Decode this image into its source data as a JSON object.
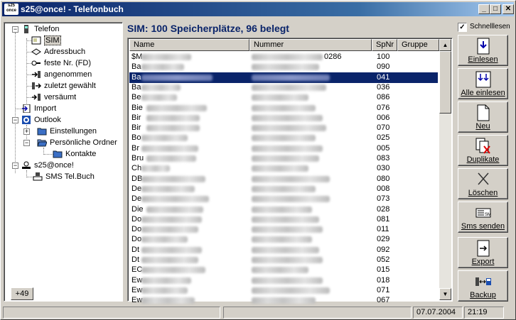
{
  "window": {
    "app_icon_text": "s25 once",
    "title": "s25@once!  -  Telefonbuch",
    "minimize": "_",
    "maximize": "□",
    "close": "✕"
  },
  "tree": {
    "nodes": [
      {
        "label": "Telefon",
        "icon": "phone-icon"
      },
      {
        "label": "SIM",
        "icon": "sim-card-icon"
      },
      {
        "label": "Adressbuch",
        "icon": "address-book-icon"
      },
      {
        "label": "feste Nr. (FD)",
        "icon": "fixed-number-icon"
      },
      {
        "label": "angenommen",
        "icon": "call-received-icon"
      },
      {
        "label": "zuletzt gewählt",
        "icon": "call-dialed-icon"
      },
      {
        "label": "versäumt",
        "icon": "call-missed-icon"
      },
      {
        "label": "Import",
        "icon": "import-icon"
      },
      {
        "label": "Outlook",
        "icon": "outlook-icon"
      },
      {
        "label": "Einstellungen",
        "icon": "folder-icon"
      },
      {
        "label": "Persönliche Ordner",
        "icon": "folder-open-icon"
      },
      {
        "label": "Kontakte",
        "icon": "folder-icon"
      },
      {
        "label": "s25@once!",
        "icon": "s25-icon"
      },
      {
        "label": "SMS Tel.Buch",
        "icon": "sms-icon"
      }
    ],
    "counter": "+49"
  },
  "main": {
    "heading": "SIM: 100 Speicherplätze, 96 belegt",
    "columns": [
      "Name",
      "Nummer",
      "SpNr",
      "Gruppe"
    ],
    "rows": [
      {
        "name": "$M",
        "number": "0286",
        "spnr": "100"
      },
      {
        "name": "Ba",
        "number": "",
        "spnr": "090"
      },
      {
        "name": "Ba",
        "number": "",
        "spnr": "041"
      },
      {
        "name": "Ba",
        "number": "",
        "spnr": "036"
      },
      {
        "name": "Be",
        "number": "",
        "spnr": "086"
      },
      {
        "name": "Bie",
        "number": "",
        "spnr": "076"
      },
      {
        "name": "Bir",
        "number": "",
        "spnr": "006"
      },
      {
        "name": "Bir",
        "number": "",
        "spnr": "070"
      },
      {
        "name": "Bo",
        "number": "",
        "spnr": "025"
      },
      {
        "name": "Br",
        "number": "",
        "spnr": "005"
      },
      {
        "name": "Bru",
        "number": "",
        "spnr": "083"
      },
      {
        "name": "Ch",
        "number": "",
        "spnr": "030"
      },
      {
        "name": "DB",
        "number": "",
        "spnr": "080"
      },
      {
        "name": "De",
        "number": "",
        "spnr": "008"
      },
      {
        "name": "De",
        "number": "",
        "spnr": "073"
      },
      {
        "name": "Die",
        "number": "",
        "spnr": "028"
      },
      {
        "name": "Do",
        "number": "",
        "spnr": "081"
      },
      {
        "name": "Do",
        "number": "",
        "spnr": "011"
      },
      {
        "name": "Do",
        "number": "",
        "spnr": "029"
      },
      {
        "name": "Dt",
        "number": "",
        "spnr": "092"
      },
      {
        "name": "Dt",
        "number": "",
        "spnr": "052"
      },
      {
        "name": "EC",
        "number": "",
        "spnr": "015"
      },
      {
        "name": "Ew",
        "number": "",
        "spnr": "018"
      },
      {
        "name": "Ew",
        "number": "",
        "spnr": "071"
      },
      {
        "name": "Ew",
        "number": "",
        "spnr": "067"
      }
    ]
  },
  "sidebar": {
    "checkbox_label": "Schnelllesen",
    "checkbox_mark": "✓",
    "buttons": [
      {
        "label": "Einlesen",
        "icon": "read-icon"
      },
      {
        "label": "Alle einlesen",
        "icon": "read-all-icon"
      },
      {
        "label": "Neu",
        "icon": "new-document-icon"
      },
      {
        "label": "Duplikate",
        "icon": "duplicates-icon"
      },
      {
        "label": "Löschen",
        "icon": "delete-icon"
      },
      {
        "label": "Sms senden",
        "icon": "sms-send-icon"
      },
      {
        "label": "Export",
        "icon": "export-icon"
      },
      {
        "label": "Backup",
        "icon": "backup-icon"
      }
    ]
  },
  "status": {
    "date": "07.07.2004",
    "time": "21:19"
  },
  "colors": {
    "title_bar": "#0a246a",
    "selection": "#0a246a",
    "window_face": "#d4d0c8"
  }
}
